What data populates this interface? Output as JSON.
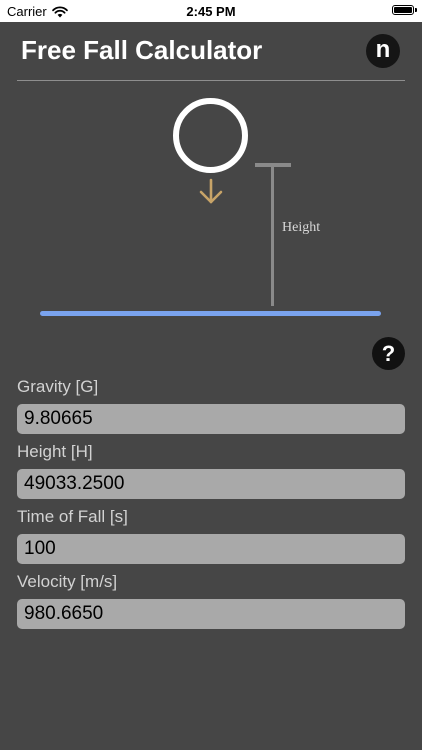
{
  "status_bar": {
    "carrier": "Carrier",
    "time": "2:45 PM",
    "wifi_icon": "wifi-icon",
    "battery_icon": "battery-icon",
    "battery_level": 1.0
  },
  "header": {
    "title": "Free Fall Calculator",
    "logo_letter": "n"
  },
  "diagram": {
    "height_label": "Height",
    "arrow_icon": "arrow-down-icon",
    "arrow_color": "#c8a468",
    "ground_color": "#7aa3ee"
  },
  "help": {
    "label": "?"
  },
  "fields": {
    "gravity": {
      "label": "Gravity [G]",
      "value": "9.80665"
    },
    "height": {
      "label": "Height [H]",
      "value": "49033.2500"
    },
    "time": {
      "label": "Time of Fall [s]",
      "value": "100"
    },
    "velocity": {
      "label": "Velocity [m/s]",
      "value": "980.6650"
    }
  }
}
